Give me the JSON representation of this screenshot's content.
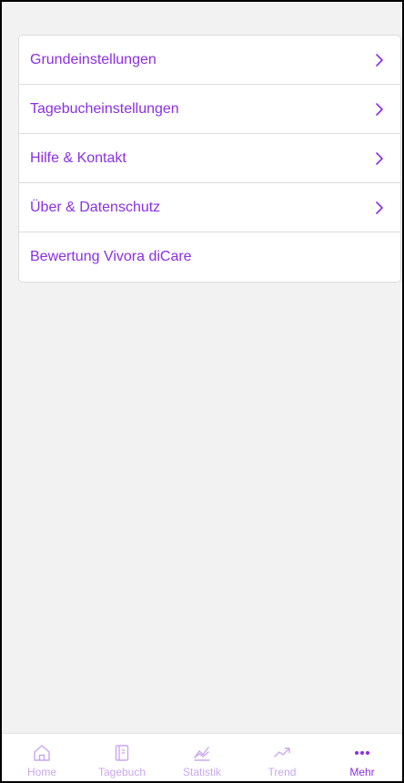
{
  "menu": {
    "items": [
      {
        "label": "Grundeinstellungen",
        "has_chevron": true
      },
      {
        "label": "Tagebucheinstellungen",
        "has_chevron": true
      },
      {
        "label": "Hilfe & Kontakt",
        "has_chevron": true
      },
      {
        "label": "Über & Datenschutz",
        "has_chevron": true
      },
      {
        "label": "Bewertung Vivora diCare",
        "has_chevron": false
      }
    ]
  },
  "tabbar": {
    "tabs": [
      {
        "label": "Home",
        "icon": "home-icon",
        "active": false
      },
      {
        "label": "Tagebuch",
        "icon": "diary-icon",
        "active": false
      },
      {
        "label": "Statistik",
        "icon": "statistics-icon",
        "active": false
      },
      {
        "label": "Trend",
        "icon": "trend-icon",
        "active": false
      },
      {
        "label": "Mehr",
        "icon": "more-icon",
        "active": true
      }
    ]
  },
  "colors": {
    "accent": "#8b2fe6",
    "accent_light": "#c9a8ef",
    "background": "#f2f2f2",
    "card": "#ffffff"
  }
}
